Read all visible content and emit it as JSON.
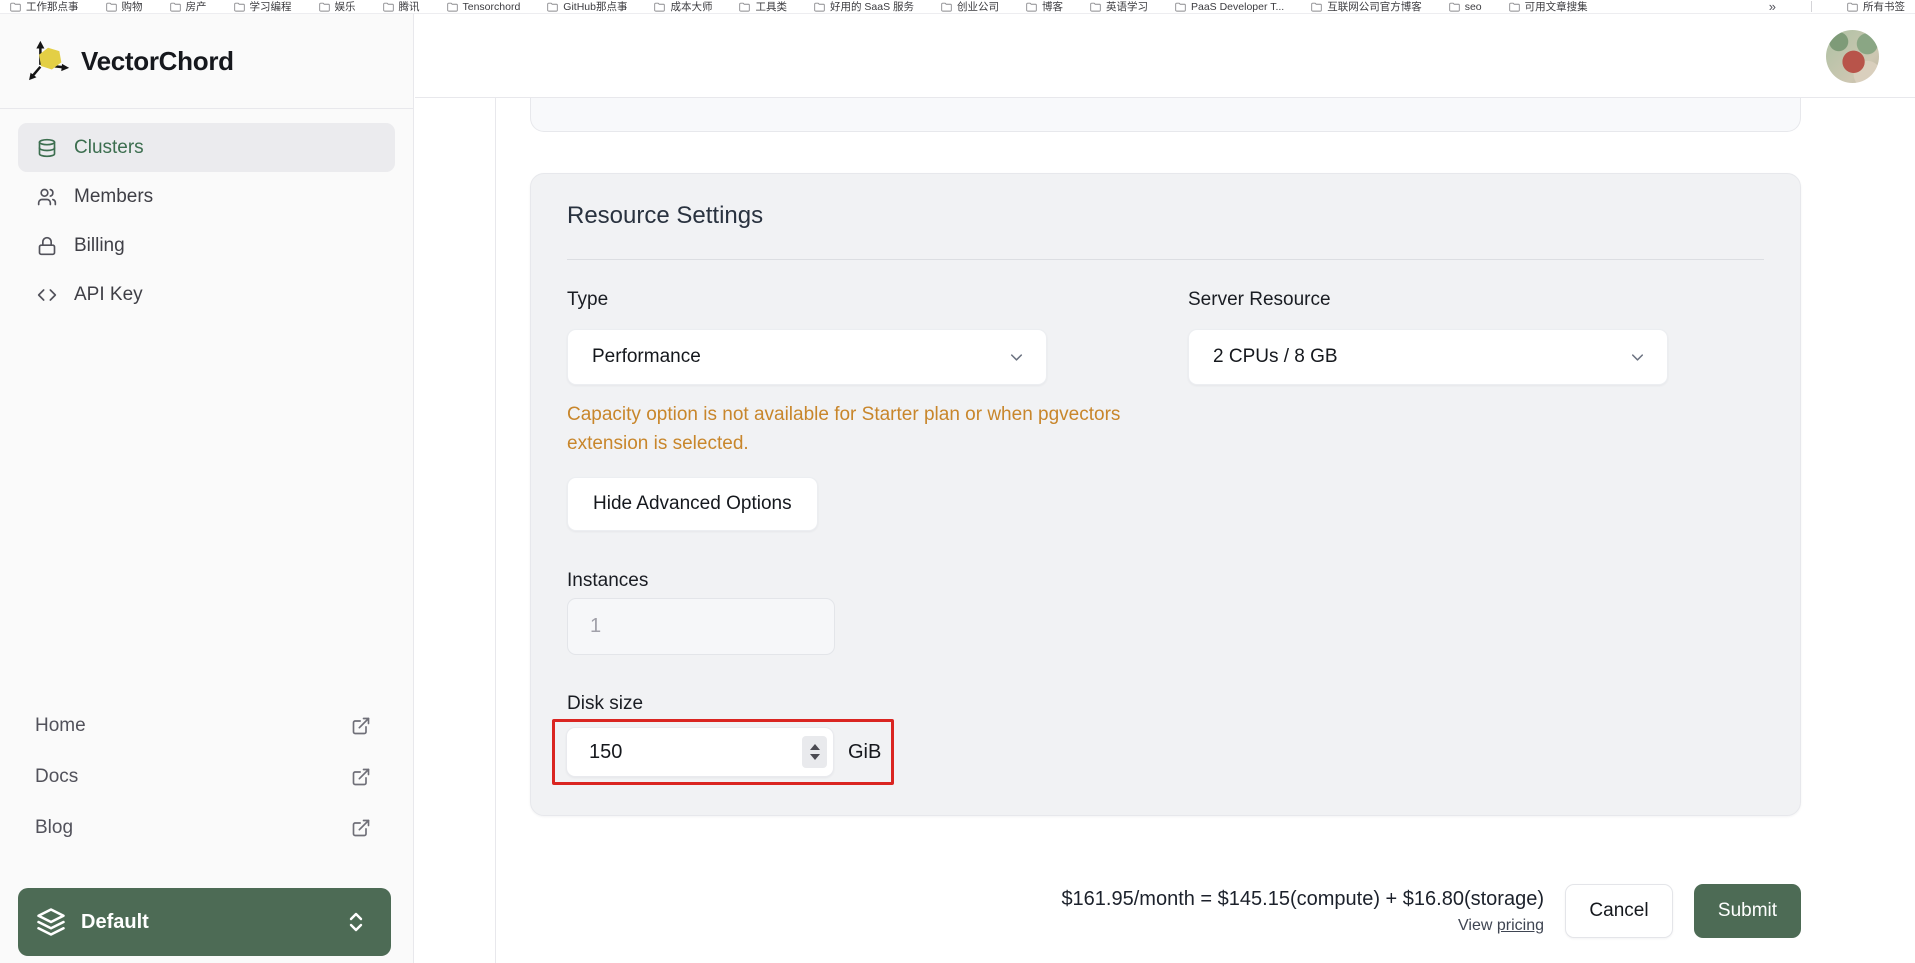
{
  "browser": {
    "bookmarks": [
      "工作那点事",
      "购物",
      "房产",
      "学习编程",
      "娱乐",
      "腾讯",
      "Tensorchord",
      "GitHub那点事",
      "成本大师",
      "工具类",
      "好用的 SaaS 服务",
      "创业公司",
      "博客",
      "英语学习",
      "PaaS Developer T...",
      "互联网公司官方博客",
      "seo",
      "可用文章搜集"
    ],
    "overflow_chevron": "»",
    "all_bookmarks": "所有书签"
  },
  "brand": {
    "name": "VectorChord"
  },
  "sidebar": {
    "nav": [
      {
        "label": "Clusters"
      },
      {
        "label": "Members"
      },
      {
        "label": "Billing"
      },
      {
        "label": "API Key"
      }
    ],
    "links": [
      {
        "label": "Home"
      },
      {
        "label": "Docs"
      },
      {
        "label": "Blog"
      }
    ],
    "project": {
      "label": "Default"
    }
  },
  "panel": {
    "title": "Resource Settings",
    "type": {
      "label": "Type",
      "value": "Performance"
    },
    "server_resource": {
      "label": "Server Resource",
      "value": "2 CPUs / 8 GB"
    },
    "warning": "Capacity option is not available for Starter plan or when pgvectors\nextension is selected.",
    "advanced_button": "Hide Advanced Options",
    "instances": {
      "label": "Instances",
      "value": "1"
    },
    "disk": {
      "label": "Disk size",
      "value": "150",
      "unit": "GiB"
    }
  },
  "footer": {
    "price_summary": "$161.95/month = $145.15(compute) + $16.80(storage)",
    "view_prefix": "View ",
    "pricing_link": "pricing",
    "cancel": "Cancel",
    "submit": "Submit"
  },
  "colors": {
    "brand_green": "#4d6b55",
    "nav_active_green": "#3c6e4f",
    "warning_orange": "#c8862b",
    "highlight_red": "#da2521",
    "panel_bg": "#f1f2f4",
    "sidebar_bg": "#fafafa"
  }
}
